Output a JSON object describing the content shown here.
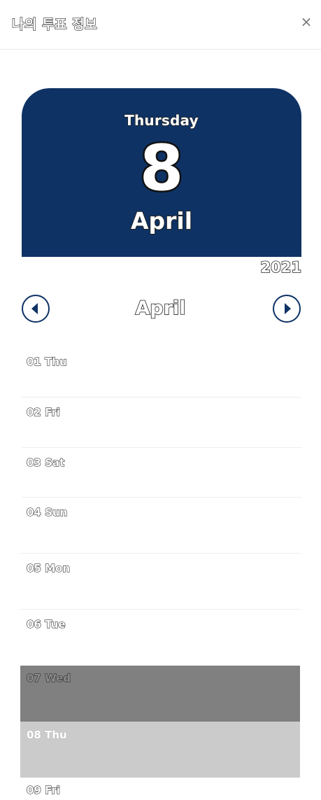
{
  "header": {
    "title": "나의 투표 정보",
    "close_label": "×"
  },
  "selected_date": {
    "weekday": "Thursday",
    "day": "8",
    "month": "April",
    "year": "2021"
  },
  "month_nav": {
    "month": "April",
    "prev_icon": "triangle-left",
    "next_icon": "triangle-right"
  },
  "days": [
    {
      "label": "01 Thu"
    },
    {
      "label": "02 Fri"
    },
    {
      "label": "03 Sat"
    },
    {
      "label": "04 Sun"
    },
    {
      "label": "05 Mon"
    },
    {
      "label": "06 Tue"
    },
    {
      "label": "07 Wed"
    },
    {
      "label": "08 Thu"
    },
    {
      "label": "09 Fri"
    }
  ],
  "colors": {
    "calendar_bg": "#0e3264",
    "row_dark": "#808080",
    "row_light": "#cbcbcb"
  }
}
